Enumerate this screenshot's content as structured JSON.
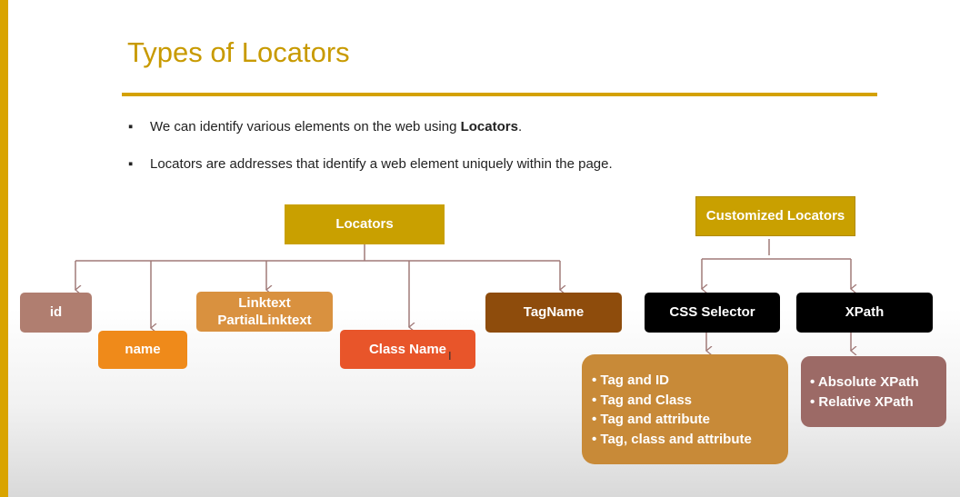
{
  "slide": {
    "title": "Types of Locators",
    "bullets": [
      {
        "marker": "▪",
        "pre": "We can identify various elements on the web using ",
        "bold": "Locators",
        "post": "."
      },
      {
        "marker": "▪",
        "pre": "Locators are addresses that identify a web element uniquely within the page.",
        "bold": "",
        "post": ""
      }
    ]
  },
  "diagram": {
    "locators": {
      "root": "Locators",
      "children": [
        "id",
        "name",
        "Linktext",
        "PartialLinktext",
        "Class Name",
        "TagName"
      ]
    },
    "customized": {
      "root": "Customized Locators",
      "css": {
        "label": "CSS Selector",
        "items": [
          "• Tag and ID",
          "• Tag and Class",
          "• Tag and attribute",
          "• Tag, class and attribute"
        ]
      },
      "xpath": {
        "label": "XPath",
        "items": [
          "• Absolute XPath",
          "• Relative XPath"
        ]
      }
    },
    "colors": {
      "gold": "#c9a000",
      "id_box": "#b07e70",
      "name_box": "#ef8a1a",
      "linktext_box": "#d9913f",
      "classname_box": "#e8552a",
      "tagname_box": "#8e4c0c",
      "black_box": "#000000",
      "css_list": "#c88a38",
      "xpath_list": "#9c6a66",
      "connector": "#a17a78"
    }
  },
  "cursor_icon": "text-cursor-icon"
}
